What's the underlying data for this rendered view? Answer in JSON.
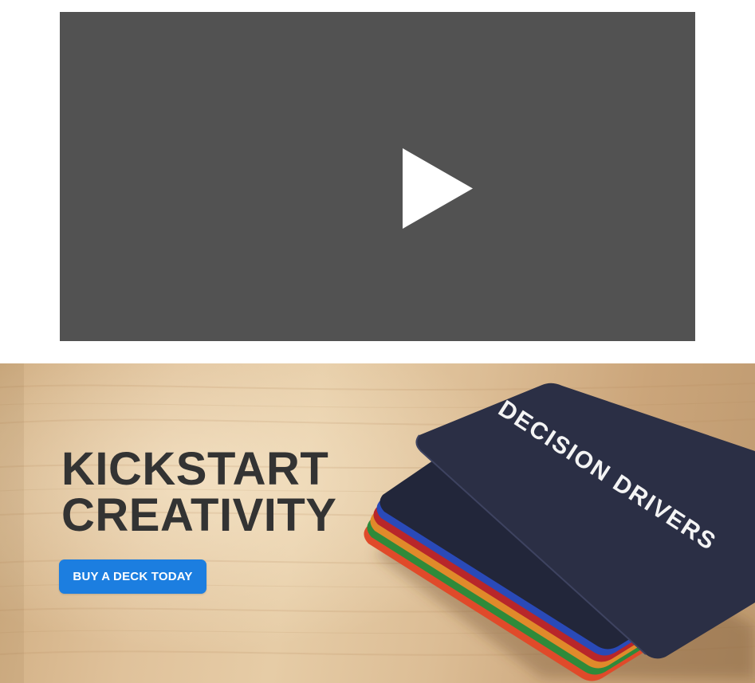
{
  "video": {
    "icon": "play-icon",
    "background_color": "#525252"
  },
  "hero": {
    "title_line1": "KICKSTART",
    "title_line2": "CREATIVITY",
    "cta_label": "BUY A DECK TODAY",
    "cta_color": "#1c7ee0",
    "card_text": "DECISION DRIVERS",
    "card_edge_colors": [
      "#e04a2a",
      "#2f8a3a",
      "#e08a2a",
      "#b8262a",
      "#2a4ab8",
      "#2b2f45"
    ]
  }
}
